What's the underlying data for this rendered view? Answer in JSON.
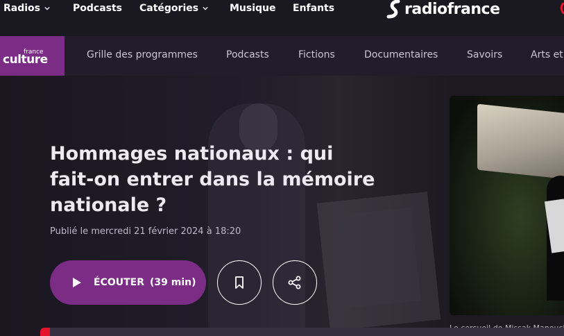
{
  "topnav": {
    "items": [
      {
        "label": "Radios",
        "has_menu": true
      },
      {
        "label": "Podcasts",
        "has_menu": false
      },
      {
        "label": "Catégories",
        "has_menu": true
      },
      {
        "label": "Musique",
        "has_menu": false
      },
      {
        "label": "Enfants",
        "has_menu": false
      }
    ],
    "brand": "radiofrance"
  },
  "station": {
    "logo_small": "france",
    "logo_big": "culture",
    "color": "#7b2d86",
    "nav": [
      "Grille des programmes",
      "Podcasts",
      "Fictions",
      "Documentaires",
      "Savoirs",
      "Arts et"
    ]
  },
  "episode": {
    "title": "Hommages nationaux : qui fait-on entrer dans la mémoire nationale ?",
    "published": "Publié le mercredi 21 février 2024 à 18:20",
    "listen_label": "ÉCOUTER",
    "duration": "(39 min)",
    "caption": "Le cercueil de Missak Manouchian"
  },
  "colors": {
    "accent": "#7b2d86",
    "background": "#1b1822",
    "player_red": "#e5142b"
  },
  "icons": {
    "play": "play-icon",
    "bookmark": "bookmark-icon",
    "share": "share-icon"
  }
}
